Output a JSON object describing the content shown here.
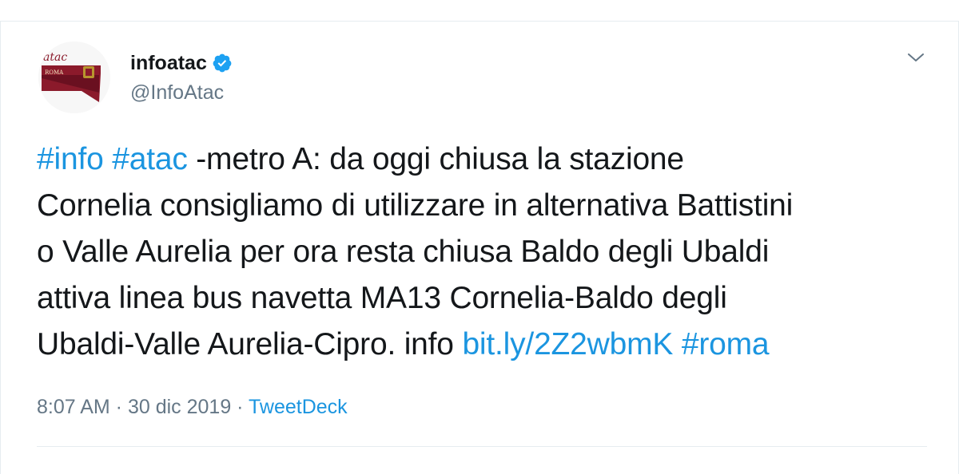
{
  "tweet": {
    "display_name": "infoatac",
    "handle": "@InfoAtac",
    "verified": true,
    "avatar": {
      "brand_text": "atac",
      "sub_text": "ROMA",
      "icon": "atac-roma-logo"
    },
    "menu_icon": "chevron-down-icon",
    "lines": [
      [
        {
          "text": "#info",
          "link": true
        },
        {
          "text": " ",
          "link": false
        },
        {
          "text": "#atac",
          "link": true
        },
        {
          "text": " -metro A: da oggi chiusa la stazione",
          "link": false
        }
      ],
      [
        {
          "text": "Cornelia consigliamo di utilizzare in alternativa Battistini",
          "link": false
        }
      ],
      [
        {
          "text": "o Valle Aurelia per ora resta chiusa Baldo degli Ubaldi",
          "link": false
        }
      ],
      [
        {
          "text": "attiva linea bus navetta MA13 Cornelia-Baldo degli",
          "link": false
        }
      ],
      [
        {
          "text": "Ubaldi-Valle Aurelia-Cipro. info ",
          "link": false
        },
        {
          "text": "bit.ly/2Z2wbmK",
          "link": true
        },
        {
          "text": " ",
          "link": false
        },
        {
          "text": "#roma",
          "link": true
        }
      ]
    ],
    "meta": {
      "time": "8:07 AM",
      "separator": " · ",
      "date": "30 dic 2019",
      "source": "TweetDeck"
    }
  },
  "colors": {
    "link": "#1b95e0",
    "text": "#14171a",
    "muted": "#657786",
    "verified": "#1da1f2",
    "atac_red": "#8b1a2b"
  }
}
